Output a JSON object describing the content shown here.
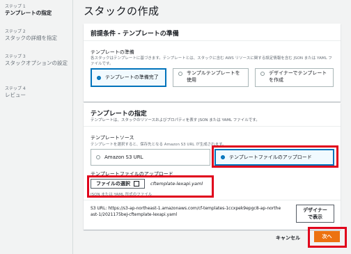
{
  "sidebar": {
    "steps": [
      {
        "num": "ステップ 1",
        "label": "テンプレートの指定"
      },
      {
        "num": "ステップ 2",
        "label": "スタックの詳細を指定"
      },
      {
        "num": "ステップ 3",
        "label": "スタックオプションの設定"
      },
      {
        "num": "ステップ 4",
        "label": "レビュー"
      }
    ]
  },
  "page": {
    "title": "スタックの作成"
  },
  "prereq": {
    "header": "前提条件 - テンプレートの準備",
    "field_label": "テンプレートの準備",
    "field_desc": "各スタックはテンプレートに基づきます。テンプレートとは、スタックに含む AWS リソースに関する設定情報を含む JSON または YAML ファイルです。",
    "options": [
      "テンプレートの準備完了",
      "サンプルテンプレートを使用",
      "デザイナーでテンプレートを作成"
    ]
  },
  "spec": {
    "header": "テンプレートの指定",
    "sub": "テンプレートは、スタックのリソースおよびプロパティを表す JSON または YAML ファイルです。",
    "source_label": "テンプレートソース",
    "source_desc": "テンプレートを選択すると、保存先となる Amazon S3 URL が生成されます。",
    "source_options": [
      "Amazon S3 URL",
      "テンプレートファイルのアップロード"
    ],
    "upload_label": "テンプレートファイルのアップロード",
    "choose_file": "ファイルの選択",
    "file_name": "cftemplate-lexapi.yaml",
    "file_hint": "JSON または YAML 形式のファイル",
    "s3_url_line1": "S3 URL:  https://s3-ap-northeast-1.amazonaws.com/cf-templates-1ccxpek9epgc8-ap-northe",
    "s3_url_line2": "ast-1/2021175beJ-cftemplate-lexapi.yaml",
    "designer_button": "デザイナーで表示"
  },
  "footer": {
    "cancel": "キャンセル",
    "next": "次へ"
  },
  "colors": {
    "primary": "#ec7211",
    "selected": "#0073bb",
    "highlight": "#e0001b"
  }
}
